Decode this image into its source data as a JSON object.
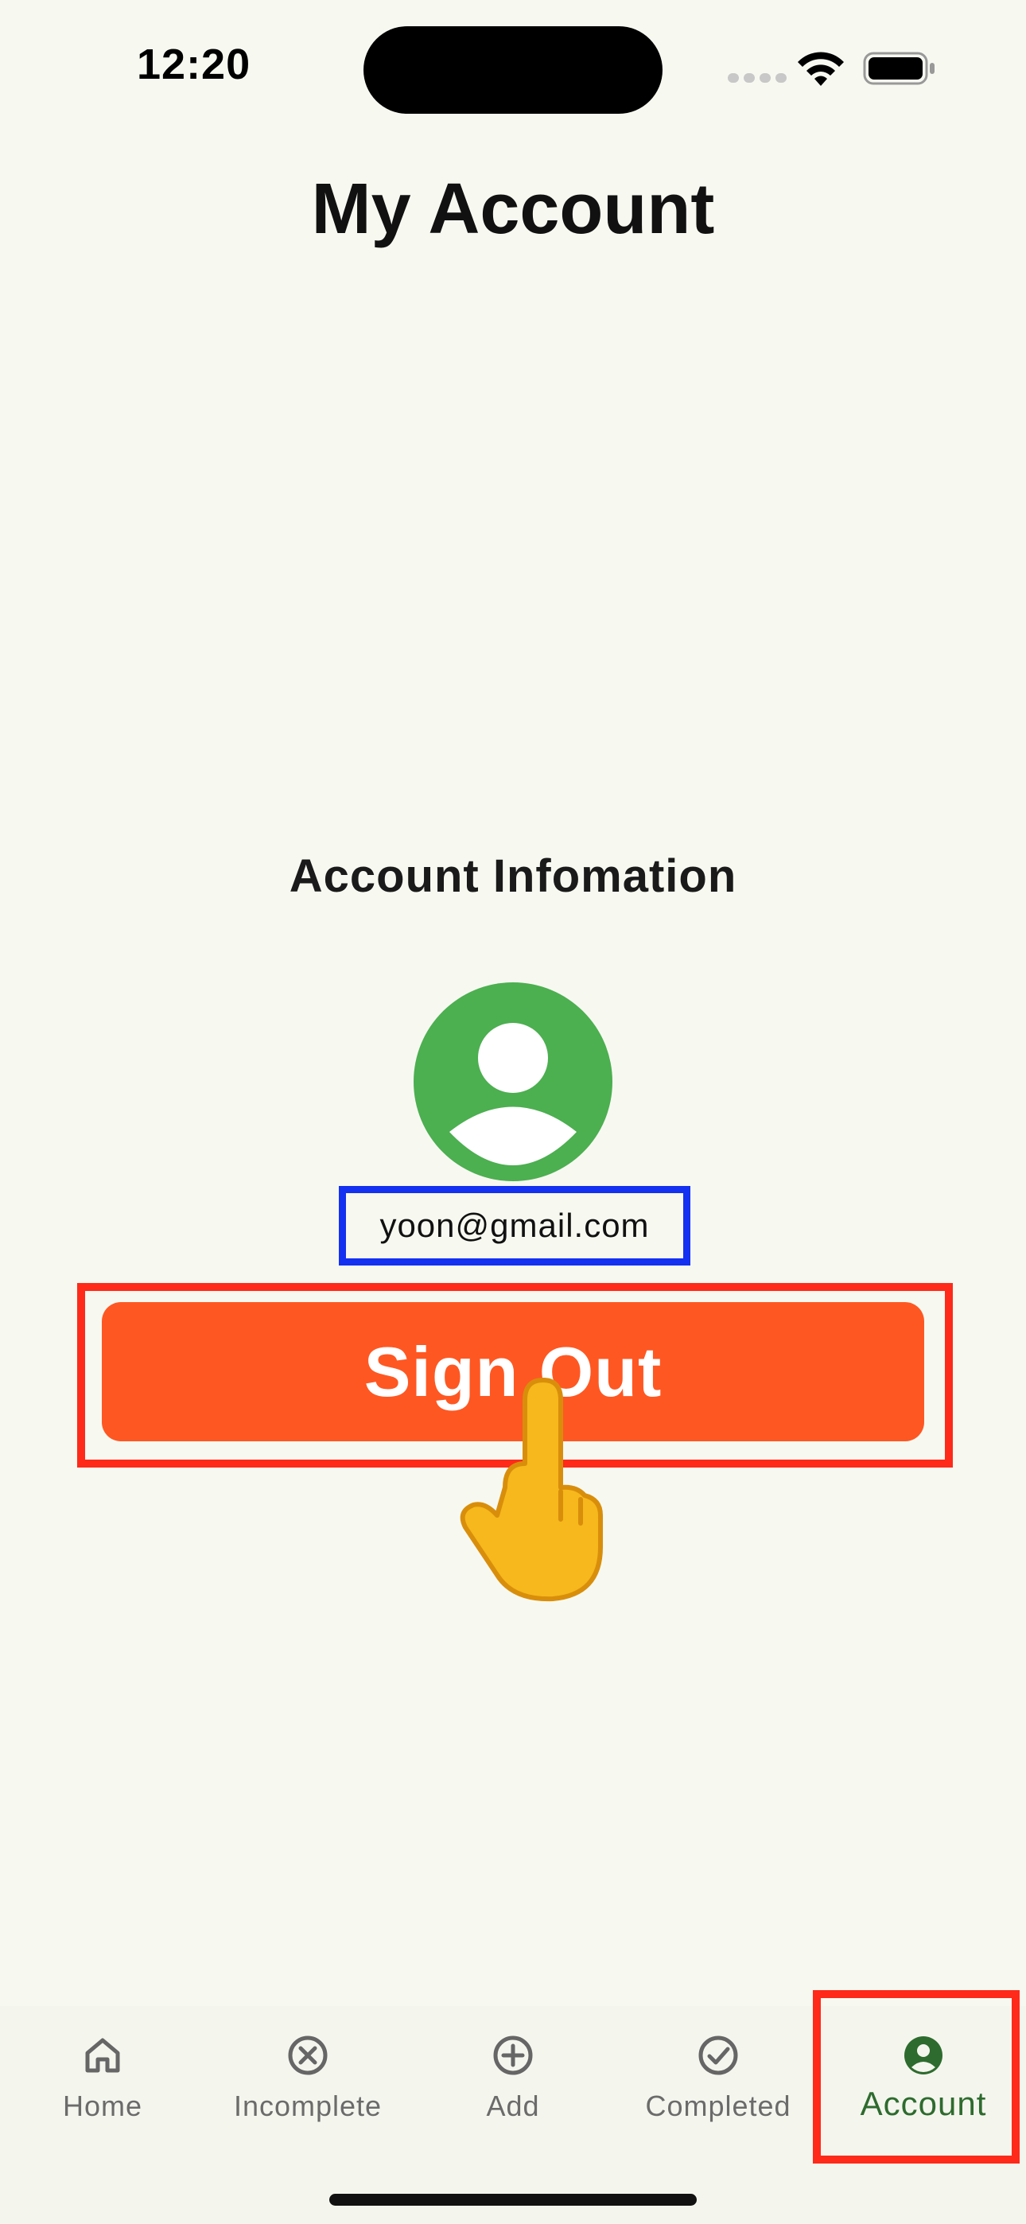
{
  "status_bar": {
    "time": "12:20"
  },
  "page": {
    "title": "My Account"
  },
  "account": {
    "section_title": "Account Infomation",
    "email": "yoon@gmail.com",
    "sign_out_label": "Sign Out"
  },
  "bottom_nav": {
    "items": [
      {
        "label": "Home",
        "icon": "home-icon"
      },
      {
        "label": "Incomplete",
        "icon": "x-circle-icon"
      },
      {
        "label": "Add",
        "icon": "plus-circle-icon"
      },
      {
        "label": "Completed",
        "icon": "check-circle-icon"
      },
      {
        "label": "Account",
        "icon": "account-circle-icon",
        "active": true
      }
    ]
  },
  "colors": {
    "background": "#F7F9F1",
    "accent_green": "#4CAF50",
    "button_orange": "#FF5722",
    "highlight_red": "#FF2A1A",
    "highlight_blue": "#1430F0",
    "active_nav": "#2E6B2E"
  }
}
